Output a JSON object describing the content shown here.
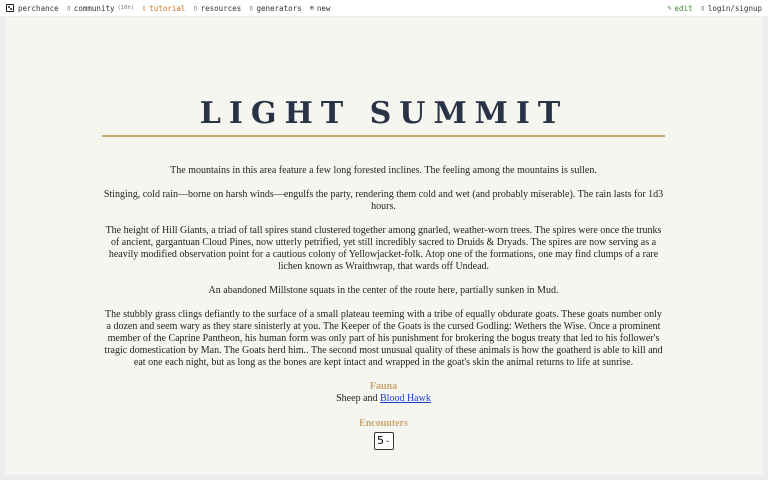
{
  "nav": {
    "left": [
      {
        "label": "perchance",
        "icon": "dice-icon"
      },
      {
        "label": "community",
        "icon": "chat-icon",
        "count": "(10h)"
      },
      {
        "label": "tutorial",
        "icon": "book-icon"
      },
      {
        "label": "resources",
        "icon": "link-icon"
      },
      {
        "label": "generators",
        "icon": "grid-icon"
      },
      {
        "label": "new",
        "icon": "plus-circle-icon"
      }
    ],
    "right": [
      {
        "label": "edit",
        "icon": "pencil-icon"
      },
      {
        "label": "login/signup",
        "icon": "user-icon"
      }
    ]
  },
  "page": {
    "title": "LIGHT SUMMIT",
    "paragraphs": [
      "The mountains in this area feature a few long forested inclines. The feeling among the mountains is sullen.",
      "Stinging, cold rain—borne on harsh winds—engulfs the party, rendering them cold and wet (and probably miserable). The rain lasts for 1d3 hours.",
      "The height of Hill Giants, a triad of tall spires stand clustered together among gnarled, weather-worn trees. The spires were once the trunks of ancient, gargantuan Cloud Pines, now utterly petrified, yet still incredibly sacred to Druids & Dryads. The spires are now serving as a heavily modified observation point for a cautious colony of Yellowjacket-folk. Atop one of the formations, one may find clumps of a rare lichen known as Wraithwrap, that wards off Undead.",
      "An abandoned Millstone squats in the center of the route here, partially sunken in Mud.",
      "The stubbly grass clings defiantly to the surface of a small plateau teeming with a tribe of equally obdurate goats. These goats number only a dozen and seem wary as they stare sinisterly at you. The Keeper of the Goats is the cursed Godling: Wethers the Wise. Once a prominent member of the Caprine Pantheon, his human form was only part of his punishment for brokering the bogus treaty that led to his follower's tragic domestication by Man. The Goats herd him.. The second most unusual quality of these animals is how the goatherd is able to kill and eat one each night, but as long as the bones are kept intact and wrapped in the goat's skin the animal returns to life at sunrise."
    ],
    "fauna_heading": "Fauna",
    "fauna_prefix": "Sheep and ",
    "fauna_link": "Blood Hawk",
    "encounters_heading": "Encounters",
    "encounters_value": "5"
  }
}
